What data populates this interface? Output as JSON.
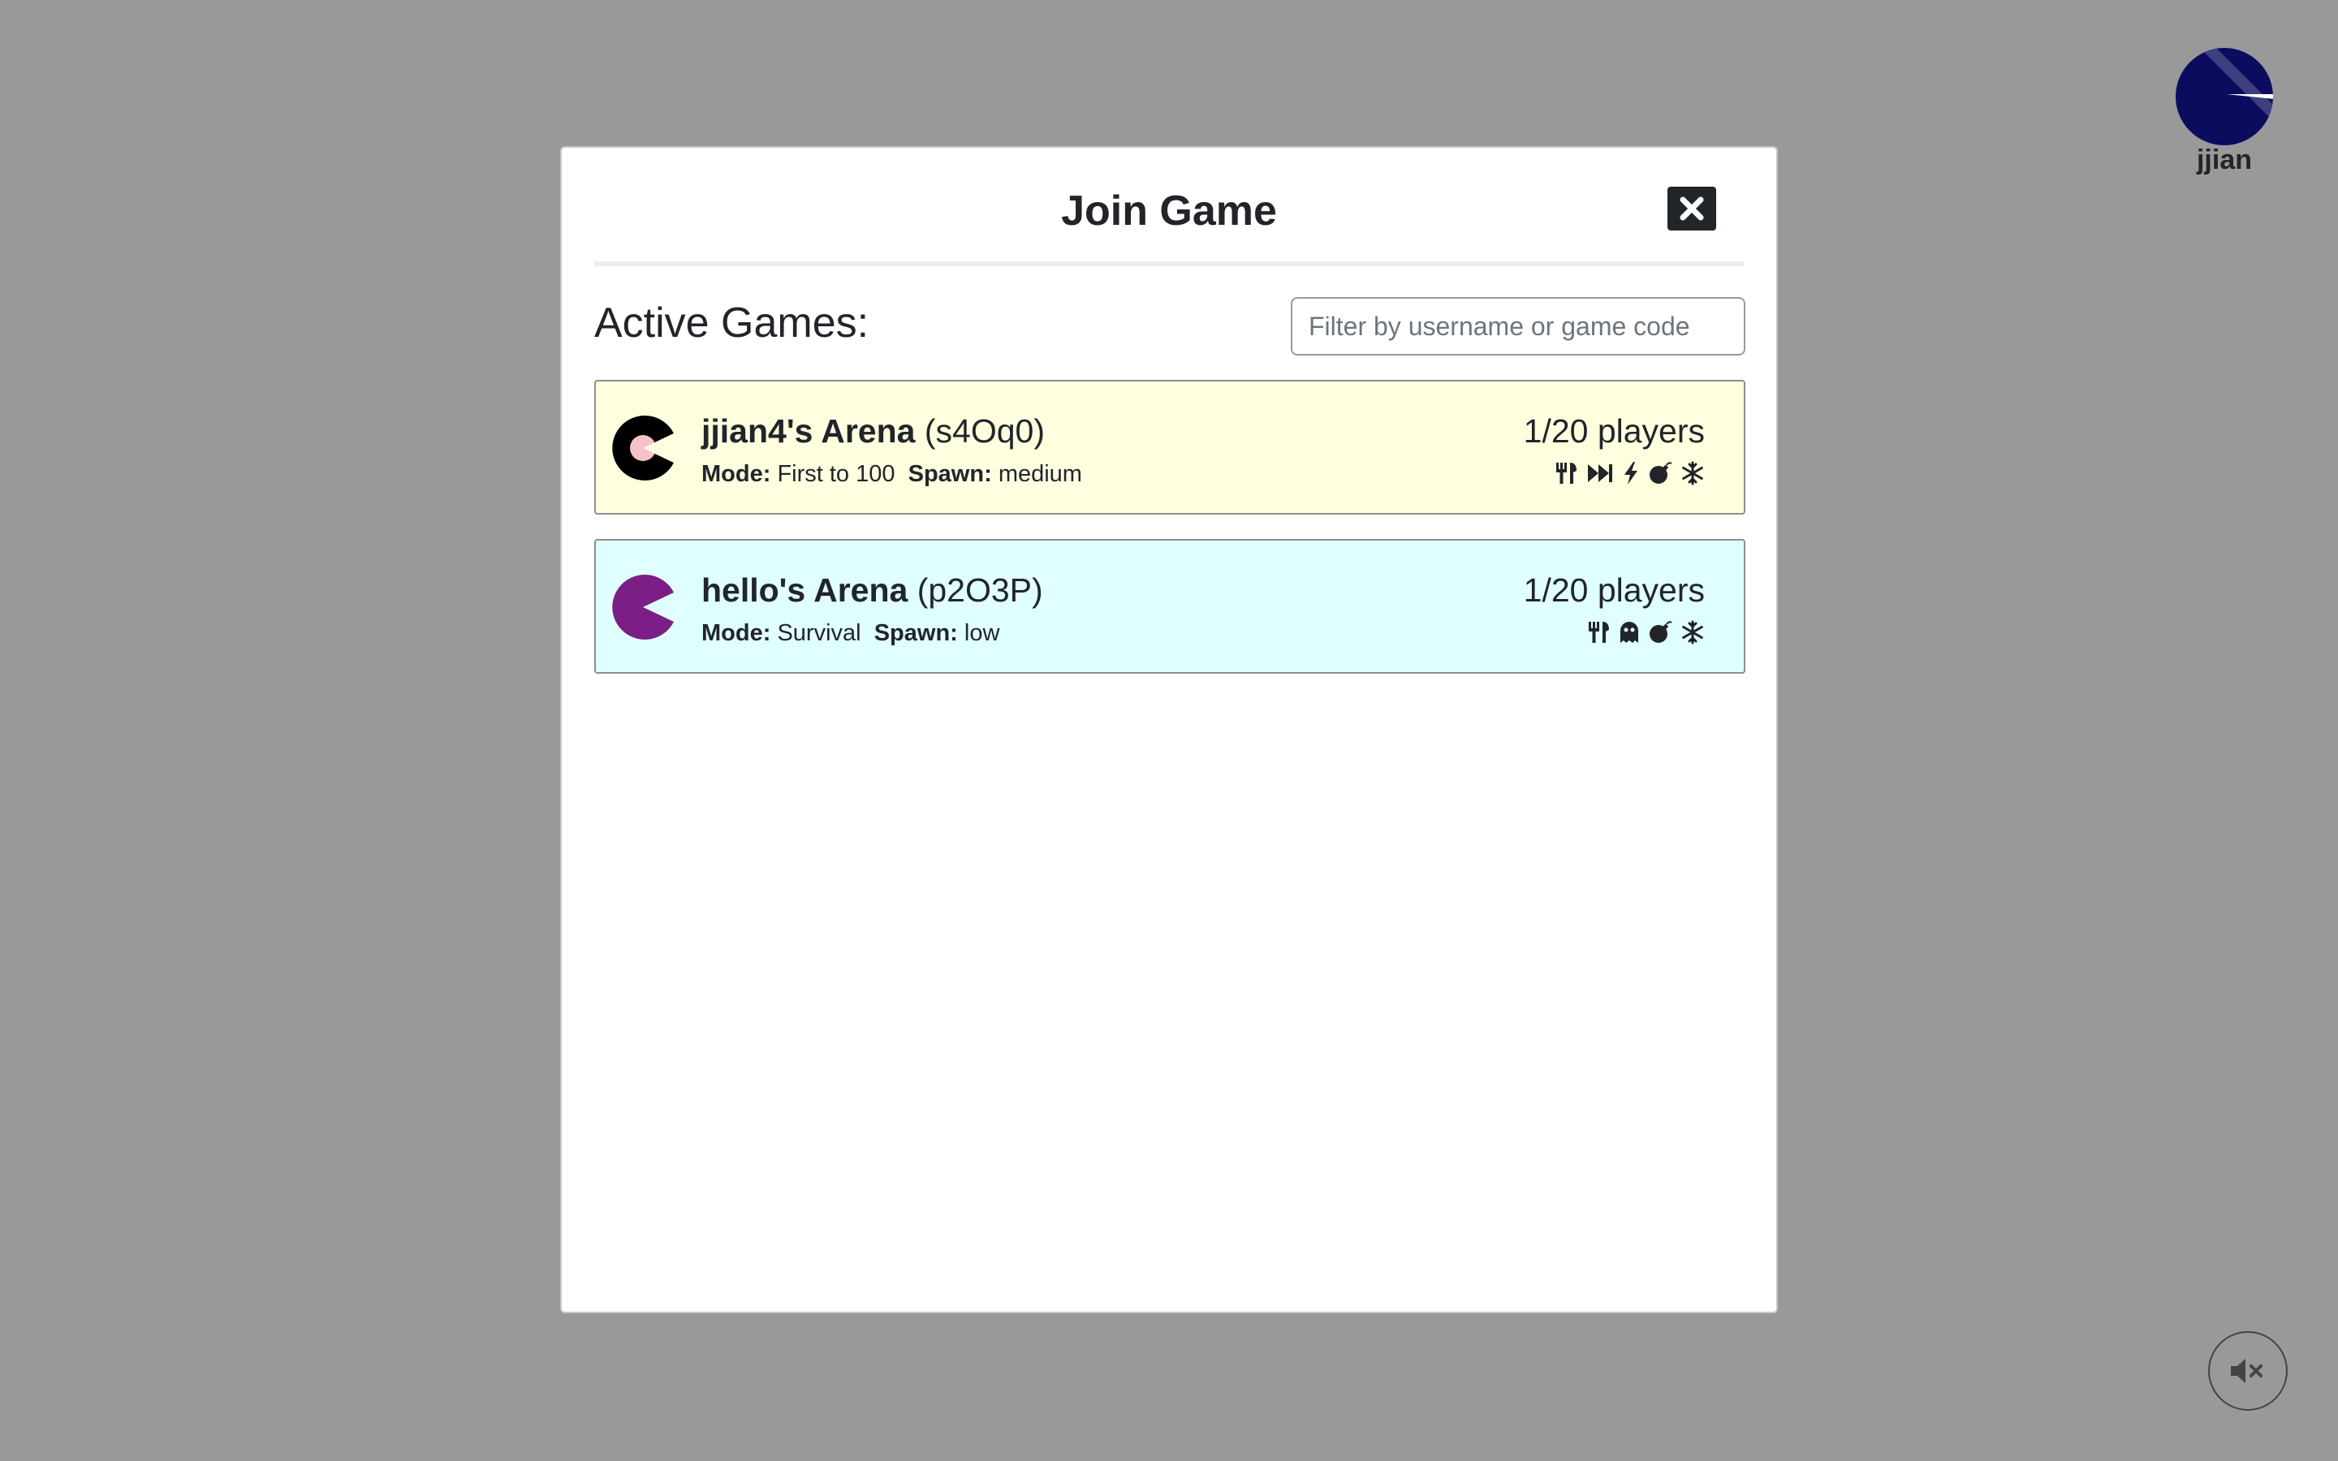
{
  "user": {
    "name": "jjian",
    "avatar_icon": "user-avatar-icon",
    "avatar_color": "#0b0c5e"
  },
  "modal": {
    "title": "Join Game",
    "close_icon": "close-icon",
    "section_title": "Active Games:",
    "filter": {
      "placeholder": "Filter by username or game code",
      "value": ""
    }
  },
  "games": [
    {
      "name": "jjian4's Arena",
      "code": "(s4Oq0)",
      "mode_label": "Mode:",
      "mode": "First to 100",
      "spawn_label": "Spawn:",
      "spawn": "medium",
      "players": "1/20 players",
      "bg_color": "#ffffe0",
      "icon": {
        "name": "pacman-icon",
        "color": "#000000",
        "inner_color": "#f4c2c8"
      },
      "powerups": [
        "utensils-icon",
        "fast-forward-icon",
        "bolt-icon",
        "bomb-icon",
        "snowflake-icon"
      ]
    },
    {
      "name": "hello's Arena",
      "code": "(p2O3P)",
      "mode_label": "Mode:",
      "mode": "Survival",
      "spawn_label": "Spawn:",
      "spawn": "low",
      "players": "1/20 players",
      "bg_color": "#e0ffff",
      "icon": {
        "name": "pacman-icon",
        "color": "#7b1f86"
      },
      "powerups": [
        "utensils-icon",
        "ghost-icon",
        "bomb-icon",
        "snowflake-icon"
      ]
    }
  ],
  "sound": {
    "icon": "volume-mute-icon",
    "state": "muted"
  }
}
